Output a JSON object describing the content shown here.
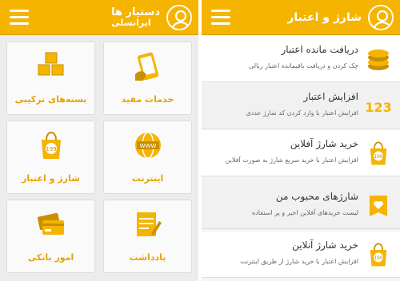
{
  "left": {
    "title_line1": "دستیار ها",
    "title_line2": "ایرانسلی",
    "tiles": [
      {
        "label": "خدمات مفید",
        "icon": "phone-hand-icon"
      },
      {
        "label": "بسته‌های ترکیبی",
        "icon": "boxes-icon"
      },
      {
        "label": "اینترنت",
        "icon": "globe-www-icon"
      },
      {
        "label": "شارژ و اعتبار",
        "icon": "shopping-bag-icon"
      },
      {
        "label": "یادداشت",
        "icon": "notepad-pencil-icon"
      },
      {
        "label": "امور بانکی",
        "icon": "bank-cards-icon"
      }
    ]
  },
  "right": {
    "title": "شارژ و اعتبار",
    "items": [
      {
        "title": "دریافت مانده اعتبار",
        "subtitle": "چک کردن و دریافت باقیمانده اعتبار ریالی",
        "icon": "coins-icon"
      },
      {
        "title": "افزایش اعتبار",
        "subtitle": "افزایش اعتبار با وارد کردن کد شارژ عددی",
        "icon": "numbers-123-icon"
      },
      {
        "title": "خرید شارژ آفلاین",
        "subtitle": "افزایش اعتبار با خرید سریع شارژ به صورت آفلاین",
        "icon": "shopping-bag-icon"
      },
      {
        "title": "شارژهای محبوب من",
        "subtitle": "لیست خریدهای آفلاین اخیر و پر استفاده",
        "icon": "heart-tag-icon"
      },
      {
        "title": "خرید شارژ آنلاین",
        "subtitle": "افزایش اعتبار با خرید شارژ از طریق اینترنت",
        "icon": "shopping-bag-icon"
      }
    ]
  },
  "colors": {
    "accent": "#f5b400",
    "label": "#e6a400",
    "icon": "#f5b400"
  }
}
